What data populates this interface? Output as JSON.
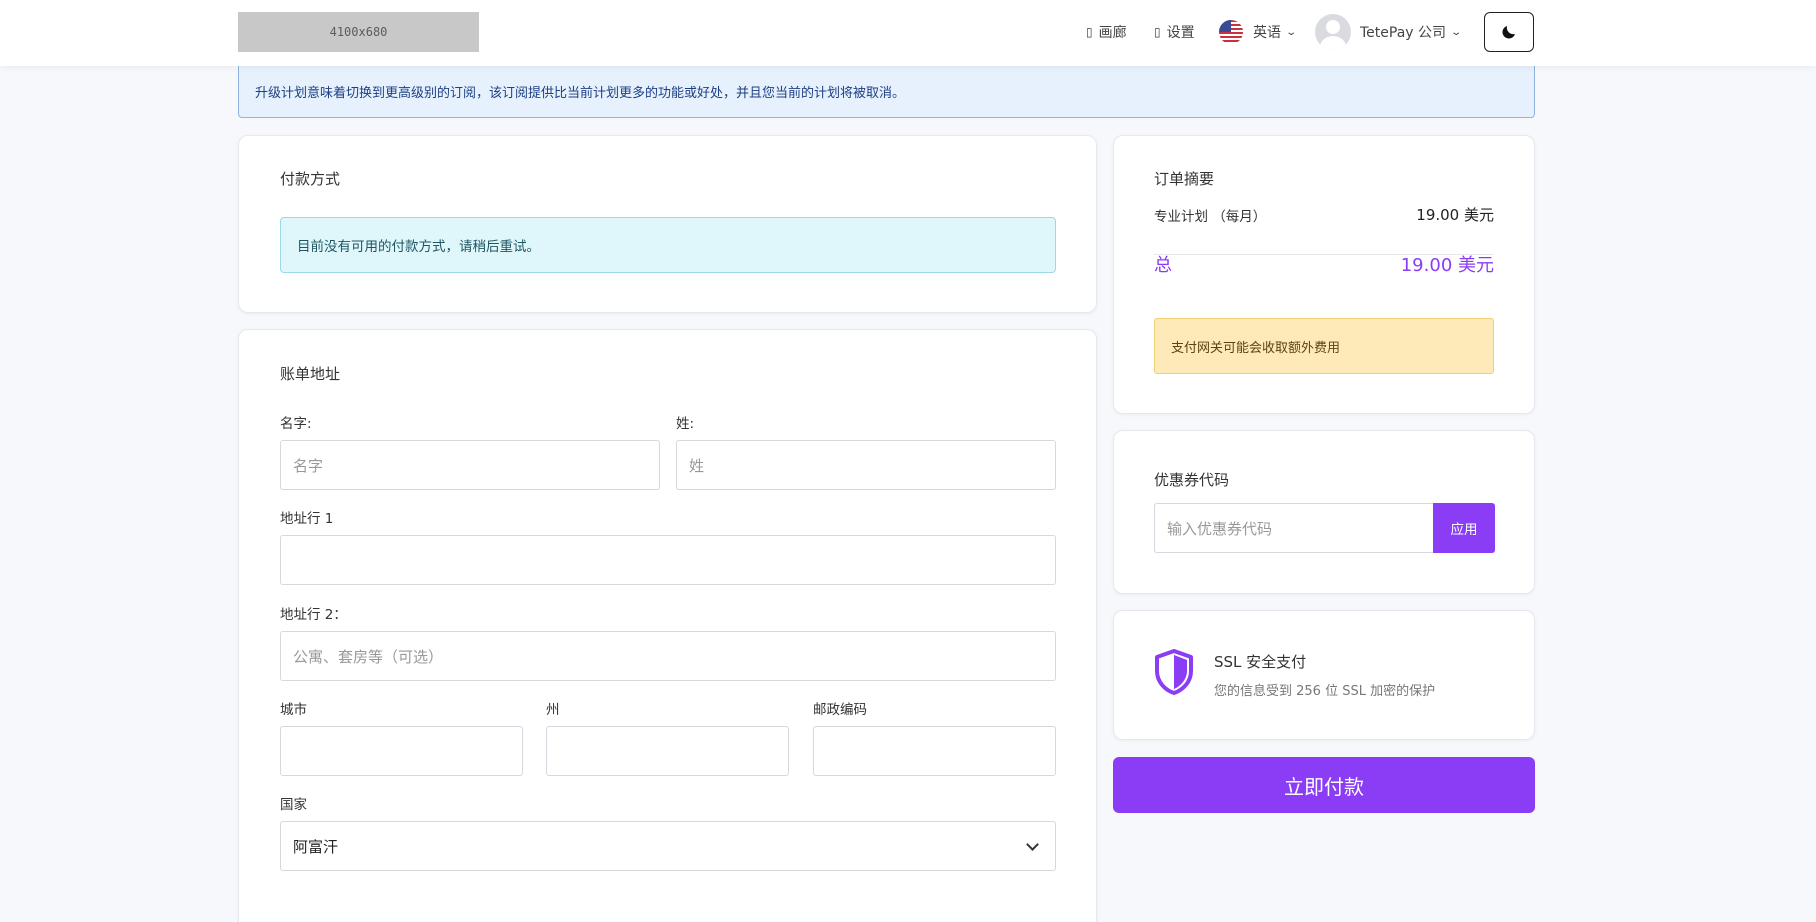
{
  "header": {
    "logo_placeholder": "4100x680",
    "gallery_label": "画廊",
    "settings_label": "设置",
    "language_label": "英语",
    "user_label": "TetePay 公司",
    "icon_glyph": "▯"
  },
  "banner": {
    "text": "升级计划意味着切换到更高级别的订阅，该订阅提供比当前计划更多的功能或好处，并且您当前的计划将被取消。"
  },
  "payment": {
    "title": "付款方式",
    "notice": "目前没有可用的付款方式，请稍后重试。"
  },
  "billing": {
    "title": "账单地址",
    "first_name_label": "名字:",
    "first_name_placeholder": "名字",
    "last_name_label": "姓:",
    "last_name_placeholder": "姓",
    "address1_label": "地址行 1",
    "address1_value": "",
    "address2_label": "地址行 2：",
    "address2_placeholder": "公寓、套房等（可选）",
    "city_label": "城市",
    "city_value": "",
    "state_label": "州",
    "state_value": "",
    "zip_label": "邮政编码",
    "zip_value": "",
    "country_label": "国家",
    "country_selected": "阿富汗"
  },
  "summary": {
    "title": "订单摘要",
    "plan_label": "专业计划 （每月）",
    "plan_price": "19.00 美元",
    "total_label": "总",
    "total_price": "19.00 美元",
    "fee_notice": "支付网关可能会收取额外费用"
  },
  "coupon": {
    "title": "优惠券代码",
    "placeholder": "输入优惠券代码",
    "apply_label": "应用"
  },
  "ssl": {
    "title": "SSL 安全支付",
    "description": "您的信息受到 256 位 SSL 加密的保护"
  },
  "pay_button_label": "立即付款",
  "colors": {
    "accent": "#8b3cf5",
    "info_bg": "#e6f1fd",
    "cyan_bg": "#dff6fb",
    "warning_bg": "#fdeab8"
  }
}
